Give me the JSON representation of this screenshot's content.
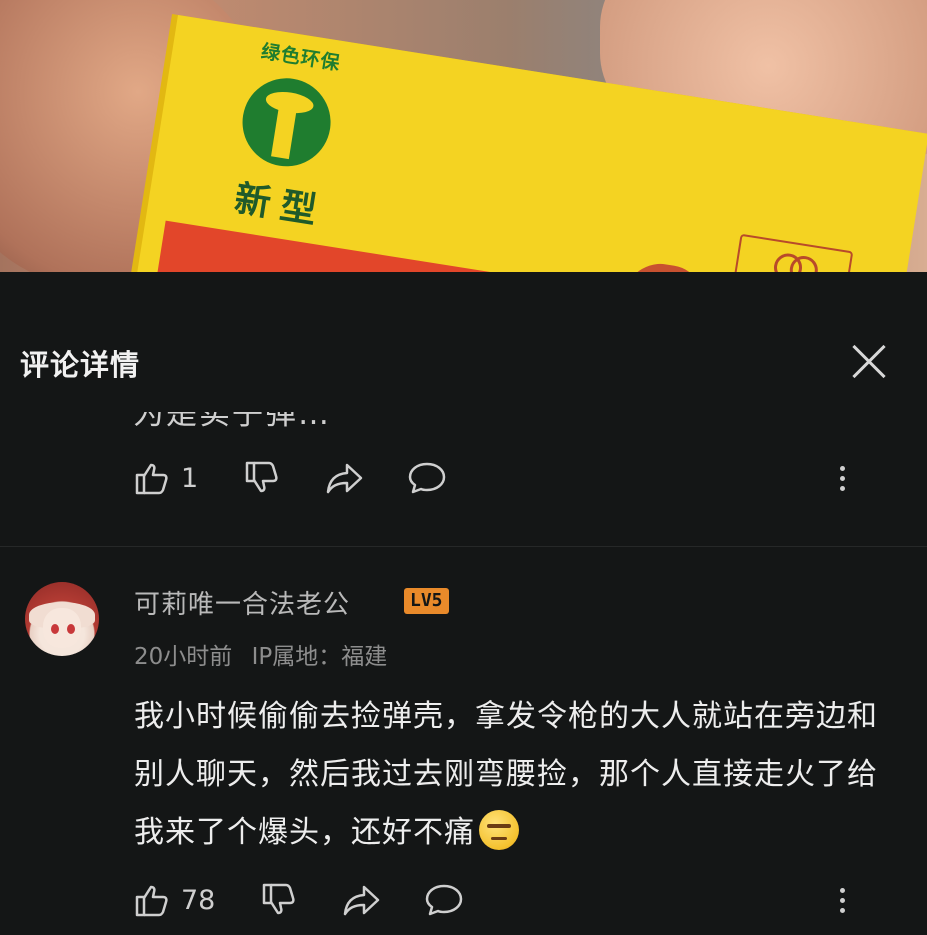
{
  "video": {
    "box_eco_text": "绿色环保",
    "box_new_type": "新型"
  },
  "header": {
    "title": "评论详情"
  },
  "previous_comment": {
    "clipped_text": "为是实子弹…",
    "likes": "1"
  },
  "comment": {
    "username": "可莉唯一合法老公",
    "level": "LV5",
    "time": "20小时前",
    "location": "IP属地：福建",
    "text": "我小时候偷偷去捡弹壳，拿发令枪的大人就站在旁边和别人聊天，然后我过去刚弯腰捡，那个人直接走火了给我来了个爆头，还好不痛",
    "emoji": "eye-roll-emoji",
    "likes": "78"
  },
  "colors": {
    "background": "#141616",
    "text_primary": "#ededed",
    "text_secondary": "#8d8d8d",
    "level_badge": "#e98a2a",
    "box_yellow": "#f4d322",
    "box_green": "#1f7d2f"
  }
}
